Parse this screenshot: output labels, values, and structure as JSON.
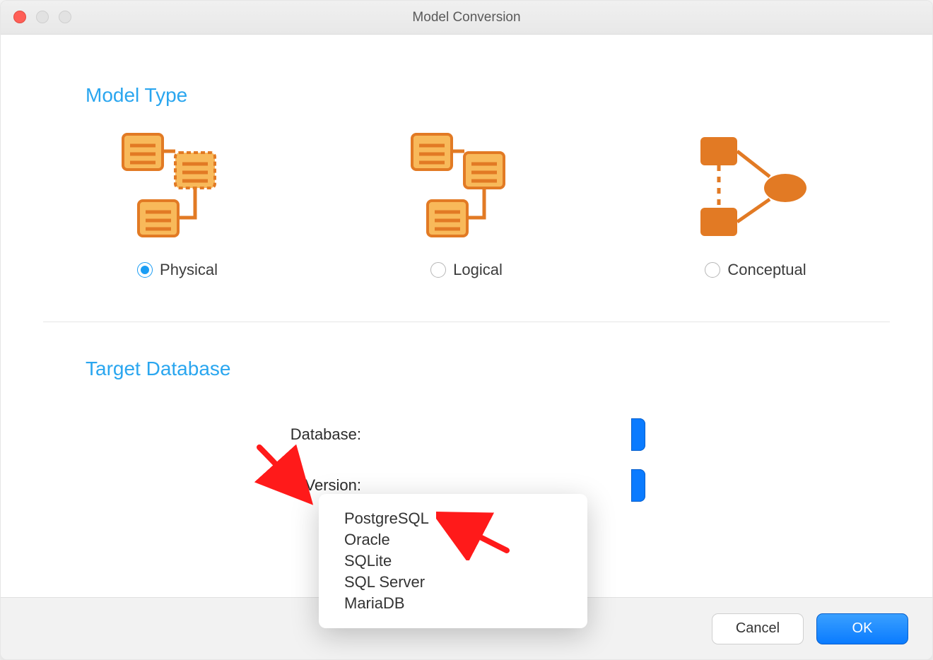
{
  "window": {
    "title": "Model Conversion"
  },
  "sections": {
    "model_type": {
      "heading": "Model Type",
      "options": [
        {
          "label": "Physical",
          "selected": true
        },
        {
          "label": "Logical",
          "selected": false
        },
        {
          "label": "Conceptual",
          "selected": false
        }
      ]
    },
    "target_database": {
      "heading": "Target Database",
      "fields": {
        "database_label": "Database:",
        "version_label": "Version:"
      },
      "dropdown_options": [
        "PostgreSQL",
        "Oracle",
        "SQLite",
        "SQL Server",
        "MariaDB"
      ]
    }
  },
  "footer": {
    "cancel": "Cancel",
    "ok": "OK"
  },
  "icons": {
    "physical": "physical-model-icon",
    "logical": "logical-model-icon",
    "conceptual": "conceptual-model-icon"
  },
  "colors": {
    "accent": "#1a9df4",
    "primary_btn": "#0a7bff",
    "heading": "#2aa6ef",
    "icon_dark": "#e27a24",
    "icon_light": "#f8b95a"
  }
}
